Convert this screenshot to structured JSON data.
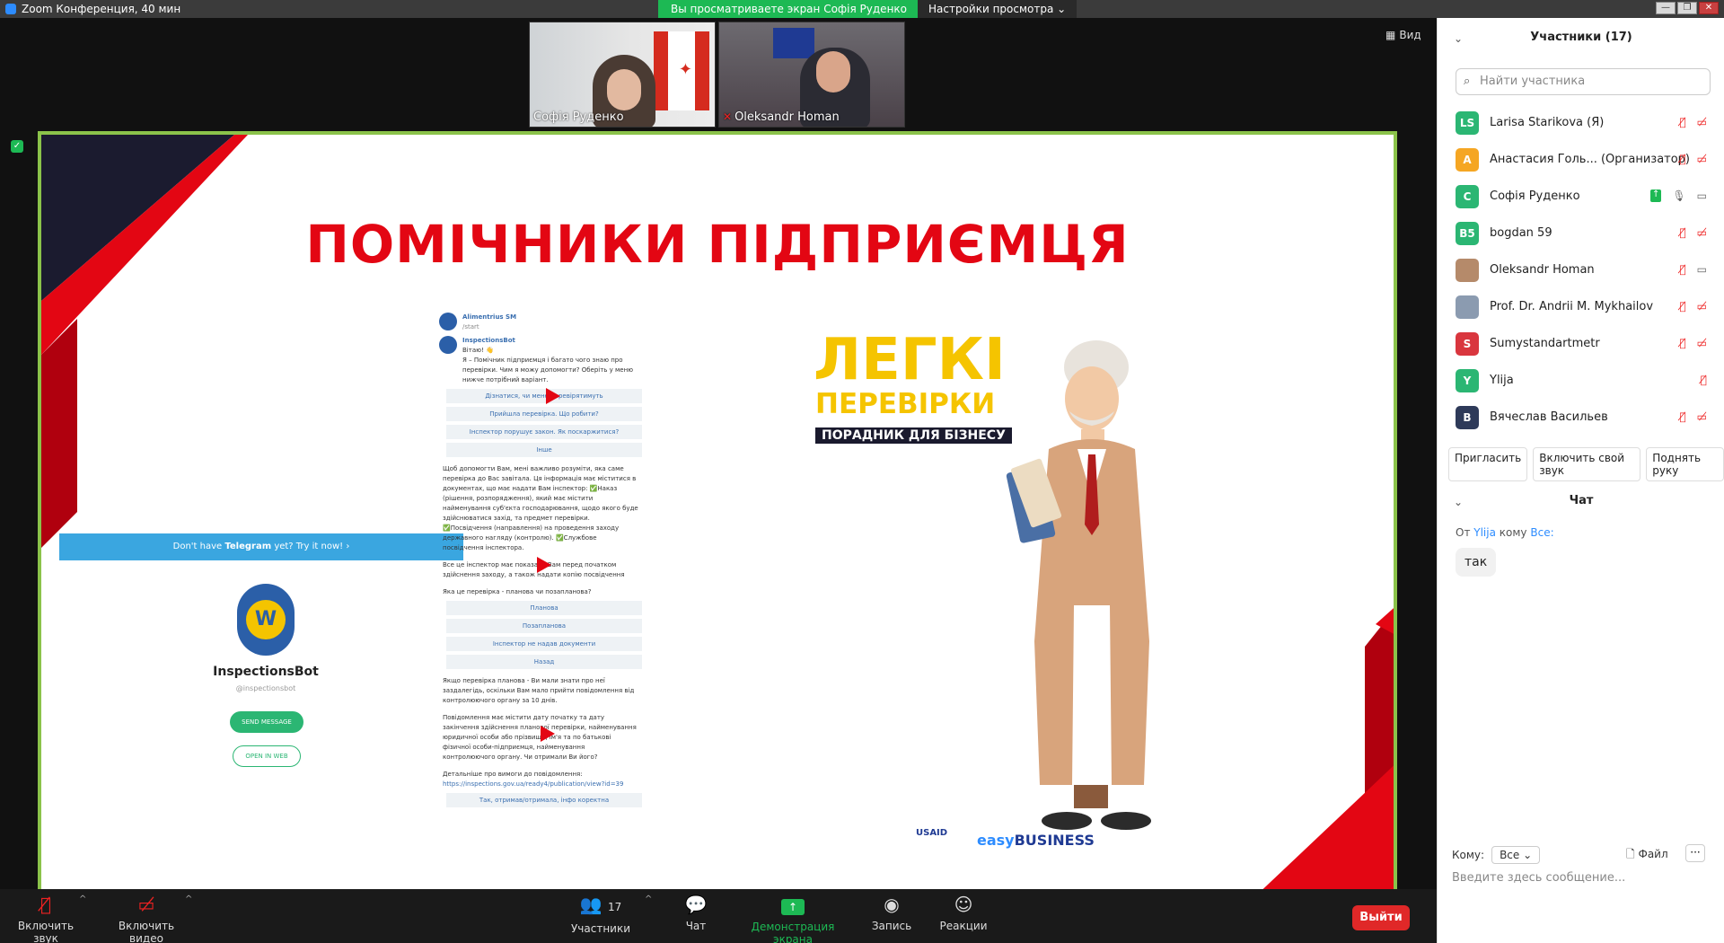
{
  "window": {
    "title": "Zoom Конференция, 40 мин",
    "share_banner": "Вы просматриваете экран Софія Руденко",
    "view_settings": "Настройки просмотра"
  },
  "videos": {
    "speaker1": "Софія Руденко",
    "speaker2": "Oleksandr Homan",
    "view_label": "Вид"
  },
  "slide": {
    "title": "ПОМІЧНИКИ ПІДПРИЄМЦЯ",
    "telegram_bar_pre": "Don't have",
    "telegram_bar_bold": "Telegram",
    "telegram_bar_post": "yet? Try it now!",
    "bot_name": "InspectionsBot",
    "bot_handle": "@inspectionsbot",
    "send_message": "SEND MESSAGE",
    "open_in_web": "OPEN IN WEB",
    "chat_user": "Alimentrius SM",
    "chat_user_cmd": "/start",
    "chat_bot": "InspectionsBot",
    "greeting": "Вітаю! 👋",
    "intro": "Я – Помічник підприємця і багато чого знаю про перевірки. Чим я можу допомогти? Оберіть у меню нижче потрібний варіант.",
    "menu1": [
      "Дізнатися, чи мене перевірятимуть",
      "Прийшла перевірка. Що робити?",
      "Інспектор порушує закон. Як поскаржитися?",
      "Інше"
    ],
    "info_para": "Щоб допомогти Вам, мені важливо розуміти, яка саме перевірка до Вас завітала. Ця інформація має міститися в документах, що має надати Вам інспектор: ✅Наказ (рішення, розпорядження), який має містити найменування суб'єкта господарювання, щодо якого буде здійснюватися захід, та предмет перевірки. ✅Посвідчення (направлення) на проведення заходу державного нагляду (контролю). ✅Службове посвідчення інспектора.",
    "info_para2": "Все це інспектор має показати Вам перед початком здійснення заходу, а також надати копію посвідчення",
    "question": "Яка це перевірка - планова чи позапланова?",
    "menu2": [
      "Планова",
      "Позапланова",
      "Інспектор не надав документи",
      "Назад"
    ],
    "planned_para": "Якщо перевірка планова - Ви мали знати про неї заздалегідь, оскільки Вам мало прийти повідомлення від контролюючого органу за 10 днів.",
    "notice_para": "Повідомлення має містити дату початку та дату закінчення здійснення планової перевірки, найменування юридичної особи або прізвище, ім'я та по батькові фізичної особи-підприємця, найменування контролюючого органу. Чи отримали Ви його?",
    "details": "Детальніше про вимоги до повідомлення:",
    "url": "https://inspections.gov.ua/ready4/publication/view?id=39",
    "menu3": "Так, отримав/отримала, інфо коректна",
    "legki": "ЛЕГКІ",
    "perevirky": "ПЕРЕВІРКИ",
    "poradnyk": "ПОРАДНИК ДЛЯ БІЗНЕСУ",
    "usaid": "USAID",
    "easy": "easy",
    "business": "BUSINESS"
  },
  "participants": {
    "header": "Участники (17)",
    "search_placeholder": "Найти участника",
    "list": [
      {
        "initials": "LS",
        "name": "Larisa Starikova (Я)",
        "color": "#2bb673"
      },
      {
        "initials": "А",
        "name": "Анастасия Голь...  (Организатор)",
        "color": "#f5a623"
      },
      {
        "initials": "С",
        "name": "Софія Руденко",
        "color": "#2bb673"
      },
      {
        "initials": "B5",
        "name": "bogdan 59",
        "color": "#2bb673"
      },
      {
        "initials": "",
        "name": "Oleksandr Homan",
        "color": "#b58a6a"
      },
      {
        "initials": "",
        "name": "Prof. Dr. Andrii M. Mykhailov",
        "color": "#8b9bb0"
      },
      {
        "initials": "S",
        "name": "Sumystandartmetr",
        "color": "#d9363e"
      },
      {
        "initials": "Y",
        "name": "Ylija",
        "color": "#2bb673"
      },
      {
        "initials": "В",
        "name": "Вячеслав Васильев",
        "color": "#2e3a59"
      }
    ],
    "invite": "Пригласить",
    "unmute": "Включить свой звук",
    "raise_hand": "Поднять руку"
  },
  "chat": {
    "header": "Чат",
    "from_prefix": "От",
    "from_name": "Ylija",
    "to_word": "кому",
    "to_name": "Все:",
    "message": "так",
    "to_label": "Кому:",
    "to_select": "Все",
    "file": "Файл",
    "compose_placeholder": "Введите здесь сообщение..."
  },
  "toolbar": {
    "audio": "Включить звук",
    "video": "Включить видео",
    "participants_count": "17",
    "participants": "Участники",
    "chat": "Чат",
    "share": "Демонстрация экрана",
    "record": "Запись",
    "reactions": "Реакции",
    "leave": "Выйти"
  }
}
